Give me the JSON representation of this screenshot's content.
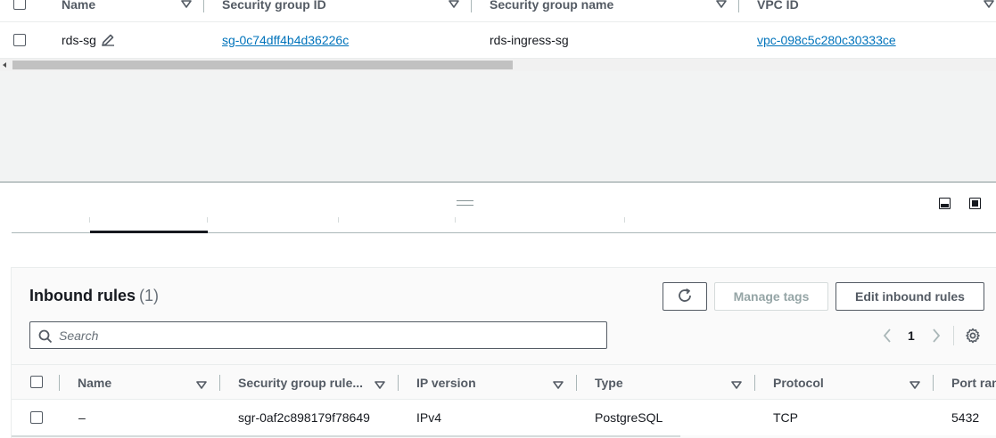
{
  "top_table": {
    "columns": [
      {
        "label": "Name"
      },
      {
        "label": "Security group ID"
      },
      {
        "label": "Security group name"
      },
      {
        "label": "VPC ID"
      }
    ],
    "rows": [
      {
        "name": "rds-sg",
        "security_group_id": "sg-0c74dff4b4d36226c",
        "security_group_name": "rds-ingress-sg",
        "vpc_id": "vpc-098c5c280c30333ce"
      }
    ]
  },
  "icons": {
    "edit": "pencil-icon",
    "sort": "sort-down-icon",
    "refresh": "refresh-icon",
    "search": "search-icon",
    "settings": "gear-icon",
    "prev": "chevron-left-icon",
    "next": "chevron-right-icon",
    "drag": "drag-handle-icon"
  },
  "inbound_rules": {
    "title": "Inbound rules",
    "count": "(1)",
    "buttons": {
      "manage_tags": "Manage tags",
      "edit_inbound_rules": "Edit inbound rules"
    },
    "search": {
      "placeholder": "Search",
      "value": ""
    },
    "pagination": {
      "current_page": "1"
    },
    "columns": [
      {
        "label": "Name"
      },
      {
        "label": "Security group rule..."
      },
      {
        "label": "IP version"
      },
      {
        "label": "Type"
      },
      {
        "label": "Protocol"
      },
      {
        "label": "Port range"
      }
    ],
    "rows": [
      {
        "name": "–",
        "security_group_rule_id": "sgr-0af2c898179f78649",
        "ip_version": "IPv4",
        "type": "PostgreSQL",
        "protocol": "TCP",
        "port_range": "5432"
      }
    ]
  },
  "colors": {
    "link": "#0073bb",
    "text": "#16191f",
    "header_text": "#545b64",
    "panel_bg": "#f2f3f3"
  }
}
